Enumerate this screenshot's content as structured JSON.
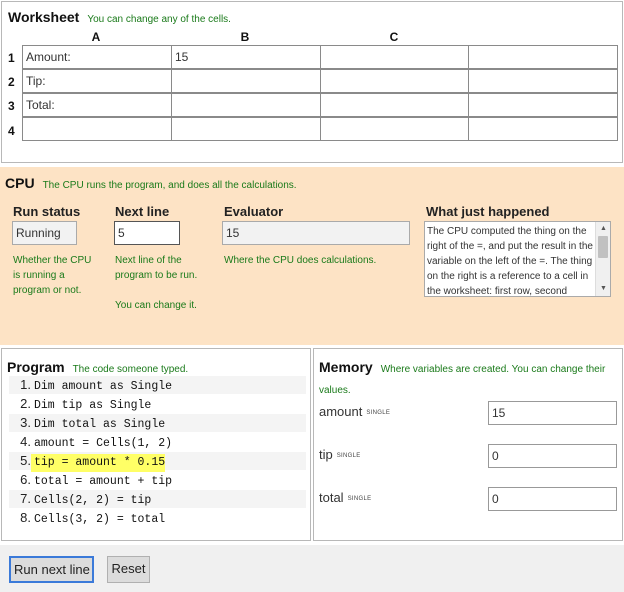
{
  "worksheet": {
    "title": "Worksheet",
    "hint": "You can change any of the cells.",
    "columns": [
      "A",
      "B",
      "C"
    ],
    "rows": [
      {
        "num": "1",
        "cells": [
          "Amount:",
          "15",
          "",
          ""
        ]
      },
      {
        "num": "2",
        "cells": [
          "Tip:",
          "",
          "",
          ""
        ]
      },
      {
        "num": "3",
        "cells": [
          "Total:",
          "",
          "",
          ""
        ]
      },
      {
        "num": "4",
        "cells": [
          "",
          "",
          "",
          ""
        ]
      }
    ]
  },
  "cpu": {
    "title": "CPU",
    "hint": "The CPU runs the program, and does all the calculations.",
    "run_status": {
      "label": "Run status",
      "value": "Running",
      "note": "Whether the CPU is running a program or not."
    },
    "next_line": {
      "label": "Next line",
      "value": "5",
      "note": "Next line of the program to be run.",
      "note2": "You can change it."
    },
    "evaluator": {
      "label": "Evaluator",
      "value": "15",
      "note": "Where the CPU does calculations."
    },
    "what_happened": {
      "label": "What just happened",
      "text": "The CPU computed the thing on the right of the =, and put the result in the variable on the left of the =. The thing on the right is a reference to a cell in the worksheet: first row, second column."
    }
  },
  "program": {
    "title": "Program",
    "hint": "The code someone typed.",
    "lines": [
      {
        "num": "1.",
        "code": "Dim amount as Single"
      },
      {
        "num": "2.",
        "code": "Dim tip as Single"
      },
      {
        "num": "3.",
        "code": "Dim total as Single"
      },
      {
        "num": "4.",
        "code": "amount = Cells(1, 2)"
      },
      {
        "num": "5.",
        "code": "tip = amount * 0.15"
      },
      {
        "num": "6.",
        "code": "total = amount + tip"
      },
      {
        "num": "7.",
        "code": "Cells(2, 2) = tip"
      },
      {
        "num": "8.",
        "code": "Cells(3, 2) = total"
      }
    ],
    "active_line": "5",
    "highlight_color": "#ffff66"
  },
  "memory": {
    "title": "Memory",
    "hint": "Where variables are created. You can change their values.",
    "variables": [
      {
        "name": "amount",
        "type": "SINGLE",
        "value": "15"
      },
      {
        "name": "tip",
        "type": "SINGLE",
        "value": "0"
      },
      {
        "name": "total",
        "type": "SINGLE",
        "value": "0"
      }
    ]
  },
  "controls": {
    "run_next": "Run next line",
    "reset": "Reset"
  },
  "colors": {
    "cpu_background": "#fde3c5",
    "hint_text": "#1a7a1a",
    "primary_focus": "#3b7ad9"
  },
  "icons": {
    "scroll_up": "triangle-up",
    "scroll_down": "triangle-down"
  }
}
